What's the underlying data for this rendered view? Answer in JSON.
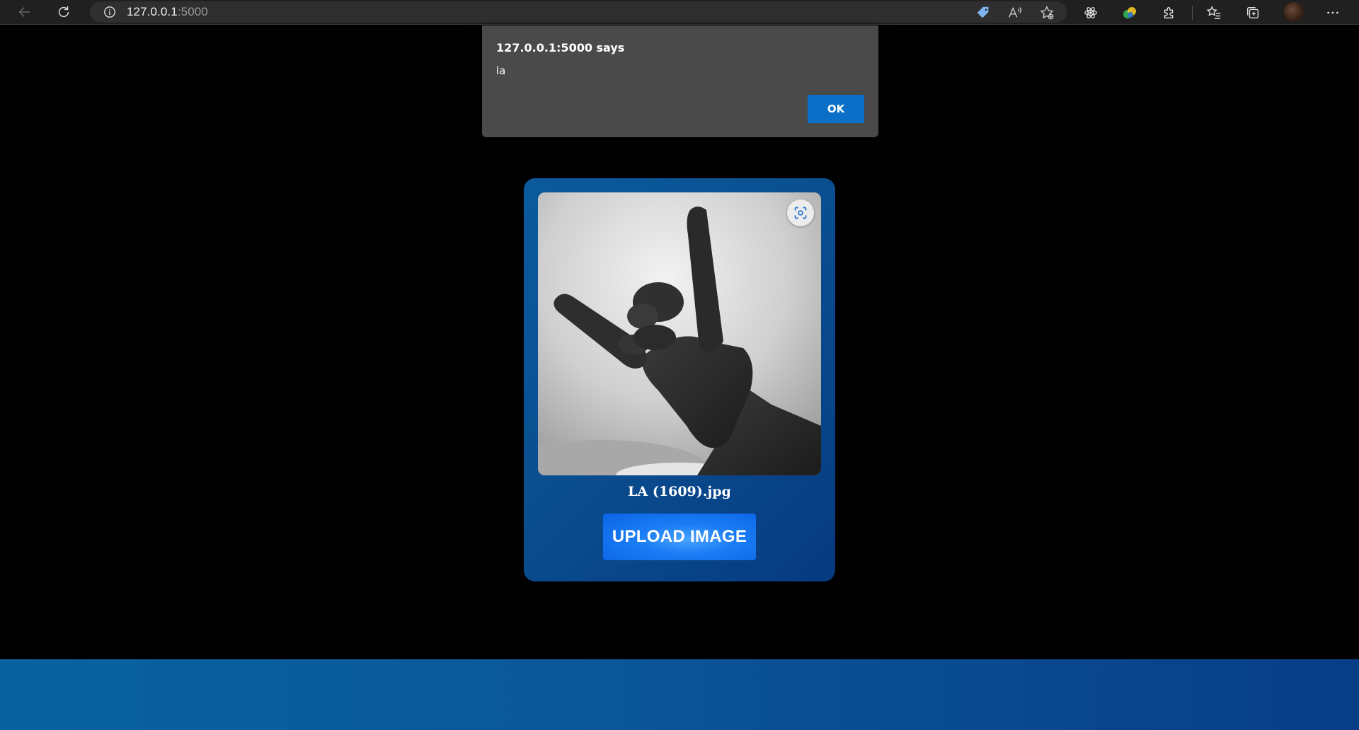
{
  "browser": {
    "url_host": "127.0.0.1",
    "url_port": ":5000"
  },
  "alert": {
    "title": "127.0.0.1:5000 says",
    "message": "la",
    "ok_label": "OK"
  },
  "upload": {
    "file_name": "LA (1609).jpg",
    "button_label": "UPLOAD IMAGE"
  },
  "colors": {
    "card_gradient_start": "#0a5a9c",
    "card_gradient_end": "#073a80",
    "upload_button": "#1b7df5",
    "alert_ok": "#0b6fc7",
    "alert_bg": "#4a4a4a"
  }
}
